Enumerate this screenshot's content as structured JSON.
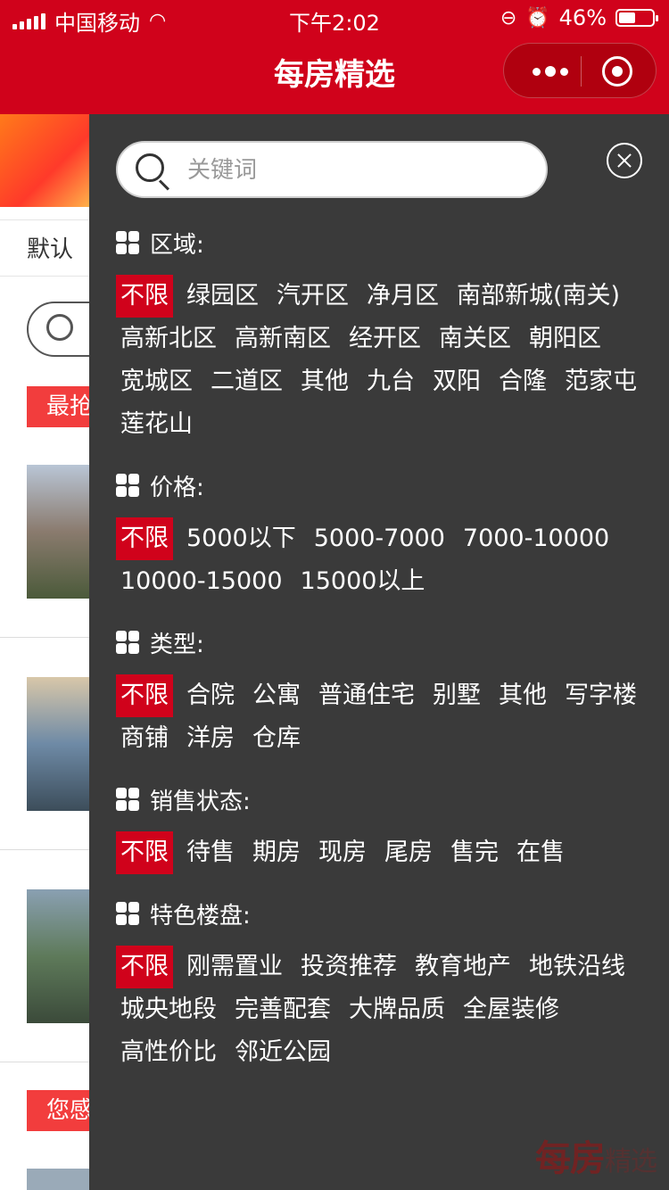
{
  "status": {
    "carrier": "中国移动",
    "time": "下午2:02",
    "battery": "46%"
  },
  "nav": {
    "title": "每房精选"
  },
  "background": {
    "sort_label": "默认",
    "tag1": "最抢",
    "tag2": "您感"
  },
  "panel": {
    "search_placeholder": "关键词",
    "sections": [
      {
        "title": "区域:",
        "options": [
          "不限",
          "绿园区",
          "汽开区",
          "净月区",
          "南部新城(南关)",
          "高新北区",
          "高新南区",
          "经开区",
          "南关区",
          "朝阳区",
          "宽城区",
          "二道区",
          "其他",
          "九台",
          "双阳",
          "合隆",
          "范家屯",
          "莲花山"
        ]
      },
      {
        "title": "价格:",
        "options": [
          "不限",
          "5000以下",
          "5000-7000",
          "7000-10000",
          "10000-15000",
          "15000以上"
        ]
      },
      {
        "title": "类型:",
        "options": [
          "不限",
          "合院",
          "公寓",
          "普通住宅",
          "别墅",
          "其他",
          "写字楼",
          "商铺",
          "洋房",
          "仓库"
        ]
      },
      {
        "title": "销售状态:",
        "options": [
          "不限",
          "待售",
          "期房",
          "现房",
          "尾房",
          "售完",
          "在售"
        ]
      },
      {
        "title": "特色楼盘:",
        "options": [
          "不限",
          "刚需置业",
          "投资推荐",
          "教育地产",
          "地铁沿线",
          "城央地段",
          "完善配套",
          "大牌品质",
          "全屋装修",
          "高性价比",
          "邻近公园"
        ]
      }
    ],
    "watermark": "每房",
    "watermark_sub": "精选"
  },
  "colors": {
    "accent": "#d0021b",
    "panel_bg": "#3a3a3a"
  }
}
